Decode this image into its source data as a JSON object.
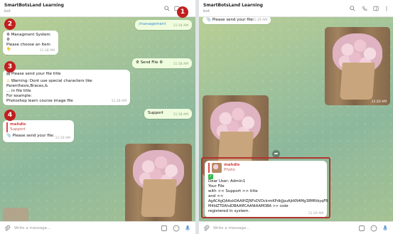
{
  "left": {
    "header": {
      "title": "SmartBotsLand Learning",
      "subtitle": "bot"
    },
    "messages": {
      "m1": {
        "text": "/management",
        "time": "11:18 AM"
      },
      "m2": {
        "line1": "Managment System",
        "line2": "Please choose an item",
        "line3": ".",
        "time": "11:18 AM"
      },
      "m3": {
        "text": "Send File",
        "time": "11:18 AM"
      },
      "m4": {
        "line1": "Please send your file title",
        "line2": "Warning: Dont use special characters like  Parenthesis,Braces,&",
        "line3": "... in file title",
        "line4": "For example:",
        "line5": "Photoshop learn course image file",
        "time": "11:18 AM"
      },
      "m5": {
        "text": "Support",
        "time": "11:18 AM"
      },
      "m6": {
        "quote_name": "mahdis",
        "quote_text": "Support",
        "text": "Please send your file:",
        "time": "11:19 AM"
      }
    },
    "composer": {
      "placeholder": "Write a message..."
    },
    "badges": {
      "b1": "1",
      "b2": "2",
      "b3": "3",
      "b4": "4"
    }
  },
  "right": {
    "header": {
      "title": "SmartBotsLand Learning",
      "subtitle": "bot"
    },
    "messages": {
      "m1": {
        "text": "Please send your file:",
        "time": "11:19 AM"
      },
      "photo1": {
        "time": "11:20 AM"
      },
      "m2": {
        "quote_name": "mahdis",
        "quote_text": "Photo",
        "line1": "Dear User: Admin1",
        "line2": "Your File",
        "line3": " with << Support >> title",
        "line4": "and <<",
        "line5": "AgACAgQAAxkDAAIHZJNFsDVDckrmKPdkJJpuAjkKN4Mg38MRtkyqFR",
        "line6": "M4IdZTDAhdDBAAMCAANtAAMOBA >> code",
        "line7": " registered in system.",
        "time": "11:20 AM"
      }
    },
    "composer": {
      "placeholder": "Write a message..."
    }
  },
  "colors": {
    "accent": "#3a8cd1",
    "highlight": "#b1342f",
    "badge": "#c21f1f",
    "outgoing": "#effdde"
  }
}
